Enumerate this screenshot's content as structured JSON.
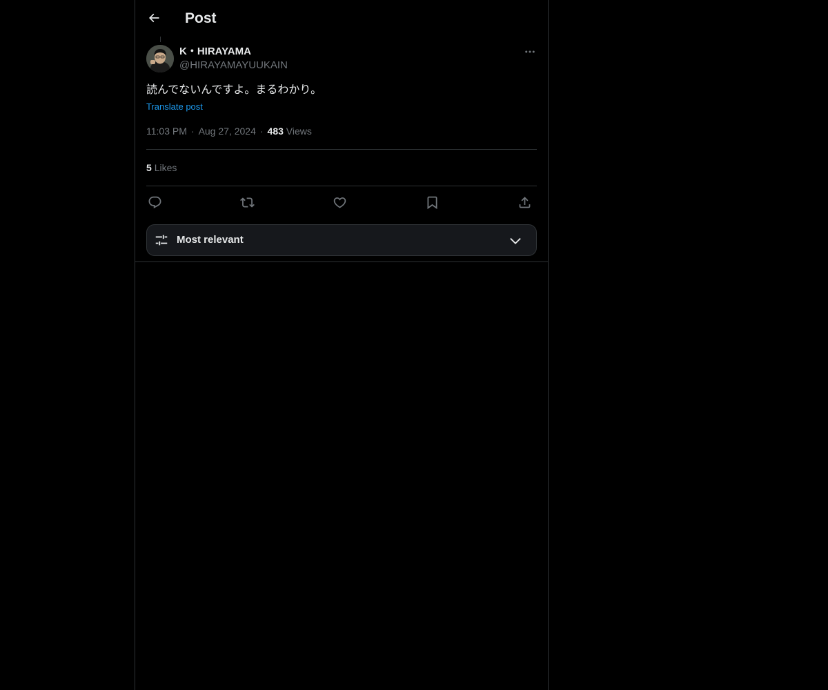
{
  "header": {
    "title": "Post",
    "back_icon": "arrow-left-icon"
  },
  "post": {
    "author": {
      "display_name": "K・HIRAYAMA",
      "handle": "@HIRAYAMAYUUKAIN",
      "avatar_icon": "avatar-photo"
    },
    "text": "読んでないんですよ。まるわかり。",
    "translate_label": "Translate post",
    "time": "11:03 PM",
    "separator": "·",
    "date": "Aug 27, 2024",
    "views_count": "483",
    "views_label": "Views",
    "likes_count": "5",
    "likes_label": "Likes"
  },
  "actions": [
    {
      "name": "reply",
      "icon": "reply-icon"
    },
    {
      "name": "repost",
      "icon": "repost-icon"
    },
    {
      "name": "like",
      "icon": "heart-icon"
    },
    {
      "name": "bookmark",
      "icon": "bookmark-icon"
    },
    {
      "name": "share",
      "icon": "share-icon"
    }
  ],
  "replies_sort": {
    "label": "Most relevant",
    "icon": "sliders-icon",
    "dropdown_icon": "chevron-down-icon"
  },
  "colors": {
    "background": "#000000",
    "text_primary": "#e7e9ea",
    "text_secondary": "#71767b",
    "link": "#1d9bf0",
    "border": "#2f3336"
  }
}
